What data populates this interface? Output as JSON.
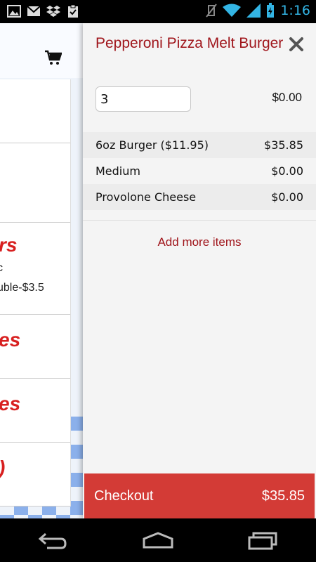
{
  "status_bar": {
    "time": "1:16"
  },
  "background": {
    "rows": [
      {
        "red": "",
        "dark": ""
      },
      {
        "red": "",
        "dark": ""
      },
      {
        "red": "rs",
        "dark": "c",
        "dark2": "uble-$3.5"
      },
      {
        "red": "es",
        "dark": ""
      },
      {
        "red": "es",
        "dark": ""
      },
      {
        "red": ")",
        "dark": ""
      }
    ]
  },
  "drawer": {
    "title": "Pepperoni Pizza Melt Burger",
    "quantity": "3",
    "quantity_price": "$0.00",
    "lines": [
      {
        "label": "6oz Burger ($11.95)",
        "amount": "$35.85"
      },
      {
        "label": "Medium",
        "amount": "$0.00"
      },
      {
        "label": "Provolone Cheese",
        "amount": "$0.00"
      }
    ],
    "add_more": "Add more items",
    "checkout_label": "Checkout",
    "checkout_total": "$35.85"
  },
  "colors": {
    "accent": "#a0161c",
    "checkout_bg": "#d33b36",
    "status_blue": "#33b5e5"
  }
}
